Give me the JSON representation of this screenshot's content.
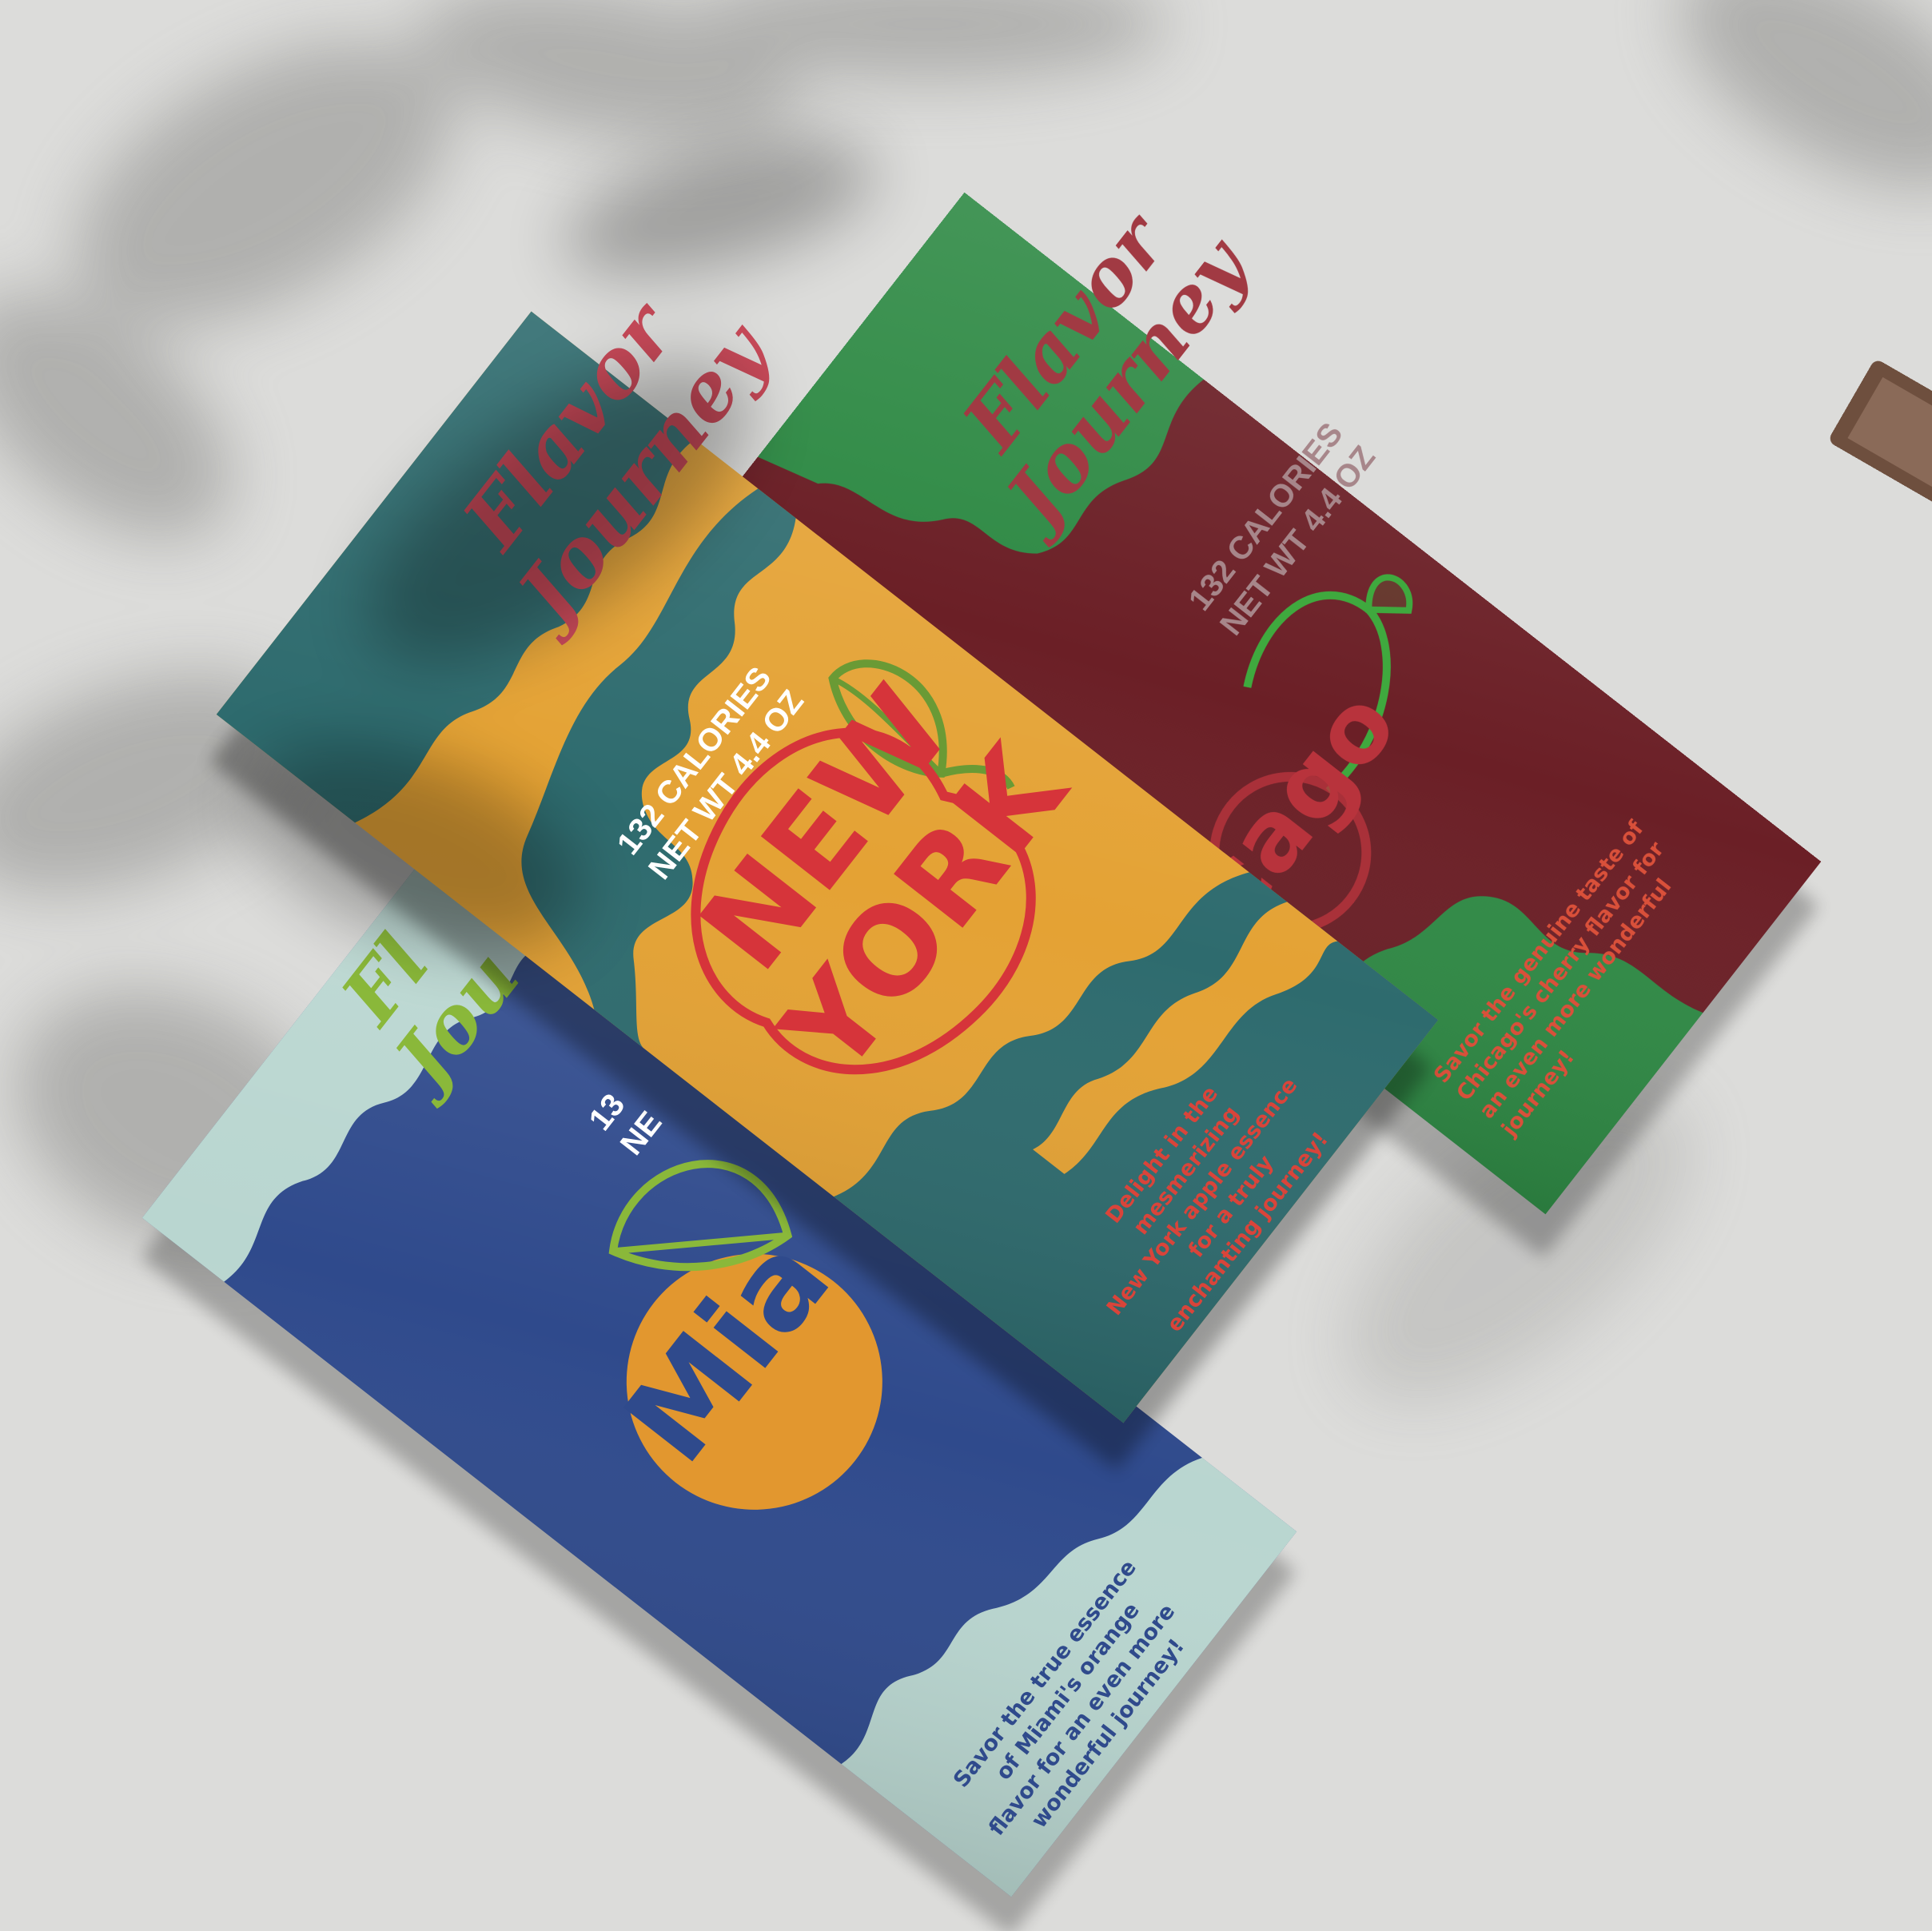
{
  "colors": {
    "background": "#dcdcda",
    "shadow": "#8c8c8a",
    "chicago_main": "#6b1f26",
    "chicago_accent": "#2f8a45",
    "chicago_brand": "#a13a43",
    "chicago_city": "#b8333c",
    "cherry_stem": "#3fa93e",
    "chicago_blurb": "#d9503a",
    "newyork_main": "#e4a234",
    "newyork_accent": "#2e6b6e",
    "newyork_brand": "#c84a59",
    "newyork_city": "#d6343a",
    "apple_leaf": "#6a9a35",
    "newyork_info": "#ffffff",
    "newyork_blurb": "#d9443a",
    "miami_main": "#2f4a8c",
    "miami_accent": "#b9d6d0",
    "miami_brand": "#8ab83a",
    "miami_city": "#e2972f",
    "orange_leaf": "#8ab83a",
    "miami_blurb": "#2f4a8c",
    "frame": "#6e4f3e"
  },
  "bars": {
    "chicago": {
      "brand_line1": "Flavor",
      "brand_line2": "Journey",
      "calories": "132 CALORIES",
      "net_wt": "NET WT 4.4 OZ",
      "city": "Chicago",
      "city_visible": "cago",
      "fruit_icon": "cherry-icon",
      "blurb_lines": [
        "Savor the genuine taste of",
        "Chicago's cherry flavor for",
        "an even more wonderful",
        "journey!"
      ]
    },
    "newyork": {
      "brand_line1": "Flavor",
      "brand_line2": "Journey",
      "calories": "132 CALORIES",
      "net_wt": "NET WT 4.4 OZ",
      "city_line1": "NEW",
      "city_line2": "YORK",
      "fruit_icon": "apple-icon",
      "blurb_lines": [
        "Delight in the",
        "mesmerizing",
        "New York apple essence",
        "for a truly",
        "enchanting journey!"
      ]
    },
    "miami": {
      "brand_line1": "Fl",
      "brand_line2": "Jou",
      "calories_visible": "13",
      "net_wt_visible": "NE",
      "city": "Miami",
      "city_visible": "Mia",
      "fruit_icon": "orange-icon",
      "blurb_lines": [
        "Savor the true essence",
        "of Miami's orange",
        "flavor for an even more",
        "wonderful journey!"
      ]
    }
  }
}
